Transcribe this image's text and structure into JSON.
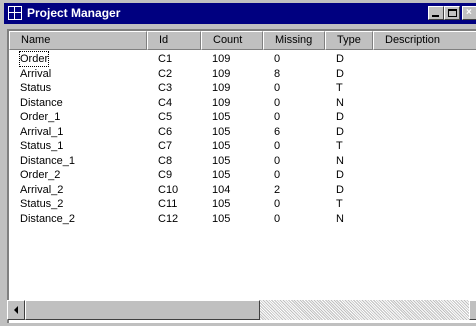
{
  "window": {
    "title": "Project Manager",
    "colors": {
      "titlebar": "#000080",
      "face": "#c0c0c0",
      "list_bg": "#ffffff"
    },
    "icons": [
      "grid-app-icon",
      "minimize-icon",
      "maximize-icon",
      "close-icon"
    ]
  },
  "table": {
    "columns": [
      "Name",
      "Id",
      "Count",
      "Missing",
      "Type",
      "Description"
    ],
    "rows": [
      [
        "Order",
        "C1",
        "109",
        "0",
        "D"
      ],
      [
        "Arrival",
        "C2",
        "109",
        "8",
        "D"
      ],
      [
        "Status",
        "C3",
        "109",
        "0",
        "T"
      ],
      [
        "Distance",
        "C4",
        "109",
        "0",
        "N"
      ],
      [
        "Order_1",
        "C5",
        "105",
        "0",
        "D"
      ],
      [
        "Arrival_1",
        "C6",
        "105",
        "6",
        "D"
      ],
      [
        "Status_1",
        "C7",
        "105",
        "0",
        "T"
      ],
      [
        "Distance_1",
        "C8",
        "105",
        "0",
        "N"
      ],
      [
        "Order_2",
        "C9",
        "105",
        "0",
        "D"
      ],
      [
        "Arrival_2",
        "C10",
        "104",
        "2",
        "D"
      ],
      [
        "Status_2",
        "C11",
        "105",
        "0",
        "T"
      ],
      [
        "Distance_2",
        "C12",
        "105",
        "0",
        "N"
      ]
    ]
  },
  "scrollbar": {
    "horizontal_position": 0.0,
    "visible_fraction": 0.53
  }
}
